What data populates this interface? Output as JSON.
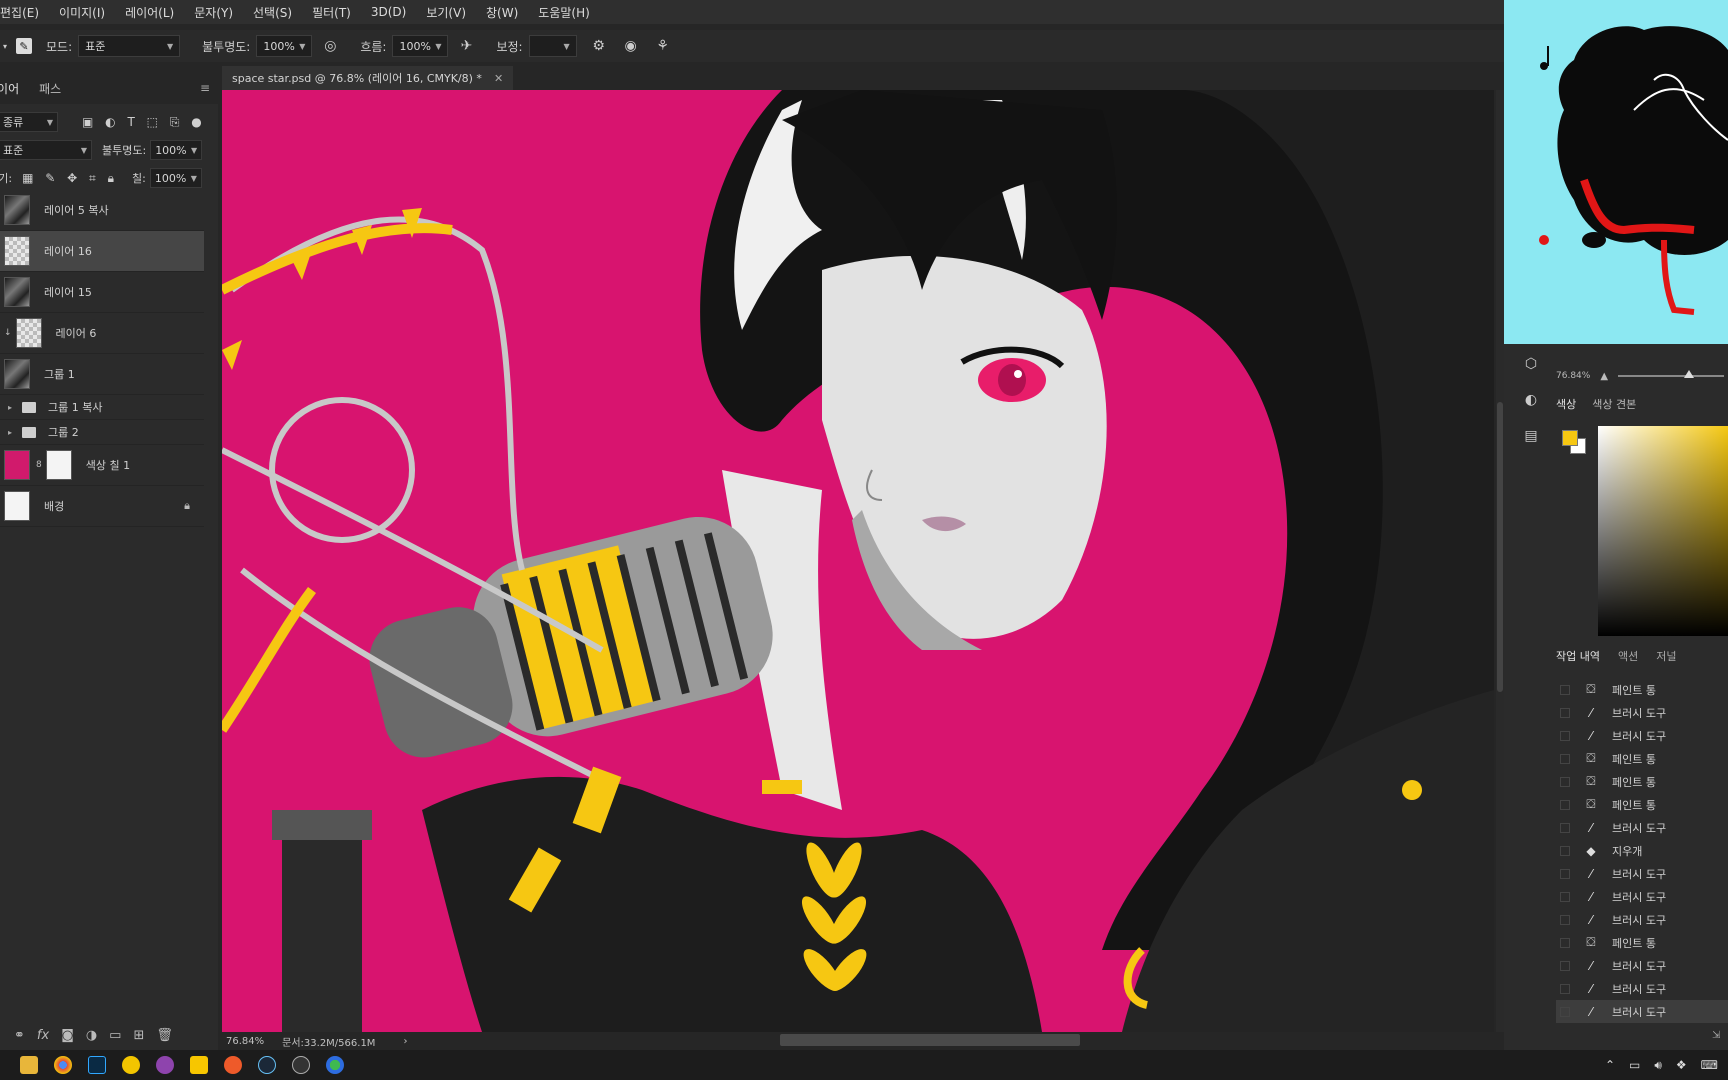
{
  "menu": [
    "편집(E)",
    "이미지(I)",
    "레이어(L)",
    "문자(Y)",
    "선택(S)",
    "필터(T)",
    "3D(D)",
    "보기(V)",
    "창(W)",
    "도움말(H)"
  ],
  "options": {
    "mode_label": "모드:",
    "mode_value": "표준",
    "opacity_label": "불투명도:",
    "opacity_value": "100%",
    "flow_label": "흐름:",
    "flow_value": "100%",
    "smoothing_label": "보정:",
    "smoothing_value": ""
  },
  "layers_panel": {
    "tabs": [
      "레이어",
      "패스"
    ],
    "filter_kind": "종류",
    "blend_mode": "표준",
    "opacity_label": "불투명도:",
    "opacity_value": "100%",
    "lock_label": "잠그기:",
    "fill_label": "칠:",
    "fill_value": "100%",
    "layers": [
      {
        "name": "레이어 5 복사",
        "thumb": "art"
      },
      {
        "name": "레이어 16",
        "thumb": "checker",
        "active": true
      },
      {
        "name": "레이어 15",
        "thumb": "art"
      },
      {
        "name": "레이어 6",
        "thumb": "checker",
        "clipped": true
      },
      {
        "name": "그룹 1",
        "thumb": "art"
      },
      {
        "name": "그룹 1 복사",
        "folder": true
      },
      {
        "name": "그룹 2",
        "folder": true
      },
      {
        "name": "색상 칠 1",
        "thumb": "pink",
        "mask": true
      },
      {
        "name": "배경",
        "thumb": "white",
        "locked": true
      }
    ]
  },
  "document": {
    "tab_title": "space star.psd @ 76.8% (레이어 16, CMYK/8) *",
    "zoom": "76.84%",
    "doc_size": "문서:33.2M/566.1M"
  },
  "right": {
    "nav_zoom": "76.84%",
    "nav_slider_fraction": 0.62,
    "color_tabs": [
      "색상",
      "색상 견본"
    ],
    "fg_color": "#f6c712",
    "bg_color": "#ffffff",
    "history_tabs": [
      "작업 내역",
      "액션",
      "저널"
    ],
    "history": [
      {
        "label": "페인트 통",
        "icon": "paint-bucket-icon"
      },
      {
        "label": "브러시 도구",
        "icon": "brush-icon"
      },
      {
        "label": "브러시 도구",
        "icon": "brush-icon"
      },
      {
        "label": "페인트 통",
        "icon": "paint-bucket-icon"
      },
      {
        "label": "페인트 통",
        "icon": "paint-bucket-icon"
      },
      {
        "label": "페인트 통",
        "icon": "paint-bucket-icon"
      },
      {
        "label": "브러시 도구",
        "icon": "brush-icon"
      },
      {
        "label": "지우개",
        "icon": "eraser-icon"
      },
      {
        "label": "브러시 도구",
        "icon": "brush-icon"
      },
      {
        "label": "브러시 도구",
        "icon": "brush-icon"
      },
      {
        "label": "브러시 도구",
        "icon": "brush-icon"
      },
      {
        "label": "페인트 통",
        "icon": "paint-bucket-icon"
      },
      {
        "label": "브러시 도구",
        "icon": "brush-icon"
      },
      {
        "label": "브러시 도구",
        "icon": "brush-icon"
      },
      {
        "label": "브러시 도구",
        "icon": "brush-icon",
        "active": true
      }
    ]
  },
  "colors": {
    "canvas_bg": "#d8146f",
    "accent_yellow": "#f6c712",
    "hair": "#151515"
  }
}
